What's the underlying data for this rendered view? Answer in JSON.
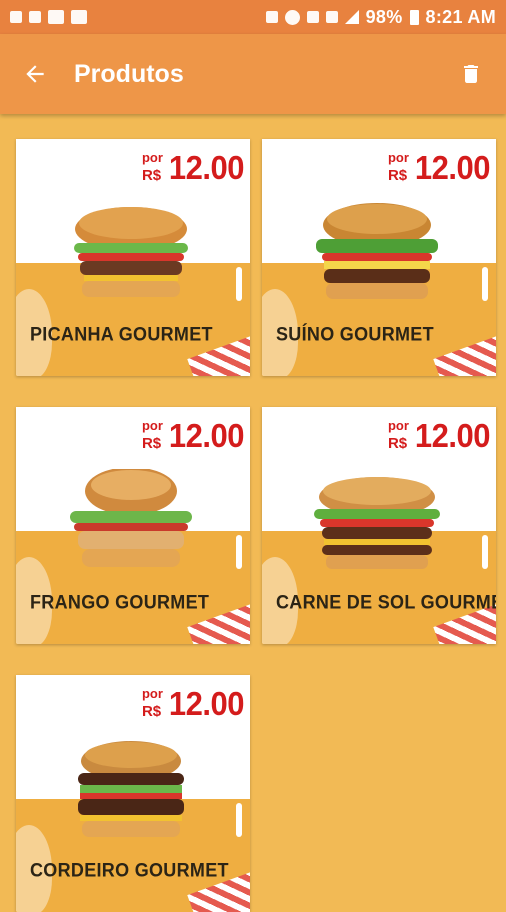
{
  "status_bar": {
    "battery": "98%",
    "time": "8:21 AM"
  },
  "app_bar": {
    "title": "Produtos"
  },
  "products": [
    {
      "name": "PICANHA GOURMET",
      "price_prefix": "por",
      "currency": "R$",
      "price": "12.00"
    },
    {
      "name": "SUÍNO GOURMET",
      "price_prefix": "por",
      "currency": "R$",
      "price": "12.00"
    },
    {
      "name": "FRANGO GOURMET",
      "price_prefix": "por",
      "currency": "R$",
      "price": "12.00"
    },
    {
      "name": "CARNE DE SOL GOURMET",
      "price_prefix": "por",
      "currency": "R$",
      "price": "12.00"
    },
    {
      "name": "CORDEIRO GOURMET",
      "price_prefix": "por",
      "currency": "R$",
      "price": "12.00"
    }
  ],
  "colors": {
    "background": "#F2BA55",
    "status_bar": "#E8823F",
    "app_bar": "#EE9648",
    "price": "#D41C1C"
  }
}
